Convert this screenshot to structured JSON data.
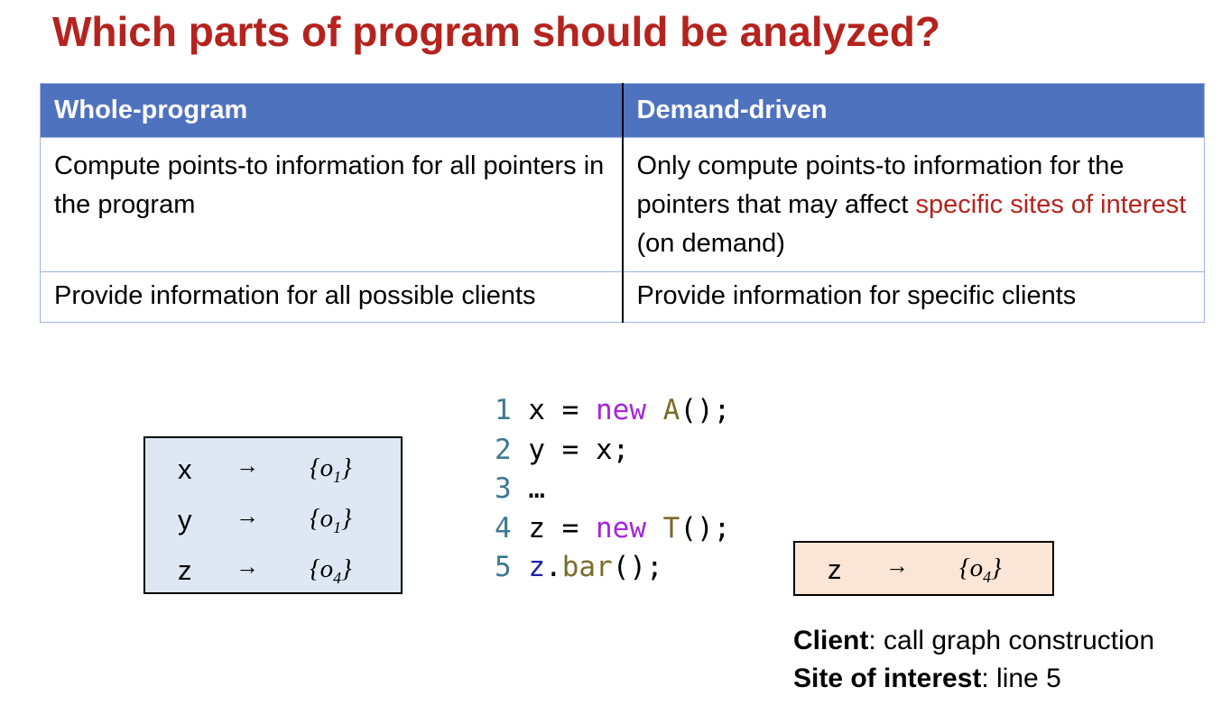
{
  "title": "Which parts of program should be analyzed?",
  "table": {
    "headers": [
      "Whole-program",
      "Demand-driven"
    ],
    "row1": {
      "left": "Compute points-to information for all pointers in the program",
      "right_before": "Only compute points-to information for the pointers that may affect ",
      "right_highlight": "specific sites of interest",
      "right_after": " (on demand)"
    },
    "row2": {
      "left": "Provide information for all possible clients",
      "right": "Provide information for specific clients"
    }
  },
  "whole_program_points_to": [
    {
      "var": "x",
      "arrow": "→",
      "set_open": "{o",
      "obj_index": "1",
      "set_close": "}"
    },
    {
      "var": "y",
      "arrow": "→",
      "set_open": "{o",
      "obj_index": "1",
      "set_close": "}"
    },
    {
      "var": "z",
      "arrow": "→",
      "set_open": "{o",
      "obj_index": "4",
      "set_close": "}"
    }
  ],
  "code": {
    "line1": {
      "num": "1",
      "pre": " x = ",
      "kw": "new",
      "sp": " ",
      "type": "A",
      "post": "();"
    },
    "line2": {
      "num": "2",
      "text": " y = x;"
    },
    "line3": {
      "num": "3",
      "text": " …"
    },
    "line4": {
      "num": "4",
      "pre": " z = ",
      "kw": "new",
      "sp": " ",
      "type": "T",
      "post": "();"
    },
    "line5": {
      "num": "5",
      "sp": " ",
      "var": "z",
      "dot": ".",
      "fn": "bar",
      "post": "();"
    }
  },
  "demand_points_to": {
    "var": "z",
    "arrow": "→",
    "set_open": "{o",
    "obj_index": "4",
    "set_close": "}"
  },
  "client_info": {
    "client_label": "Client",
    "client_value": ": call graph construction",
    "site_label": "Site of interest",
    "site_value": ": line 5"
  },
  "colors": {
    "title_red": "#b5231e",
    "header_blue": "#4f72be",
    "whole_box_bg": "#dee8f4",
    "demand_box_bg": "#fbe5d6"
  }
}
